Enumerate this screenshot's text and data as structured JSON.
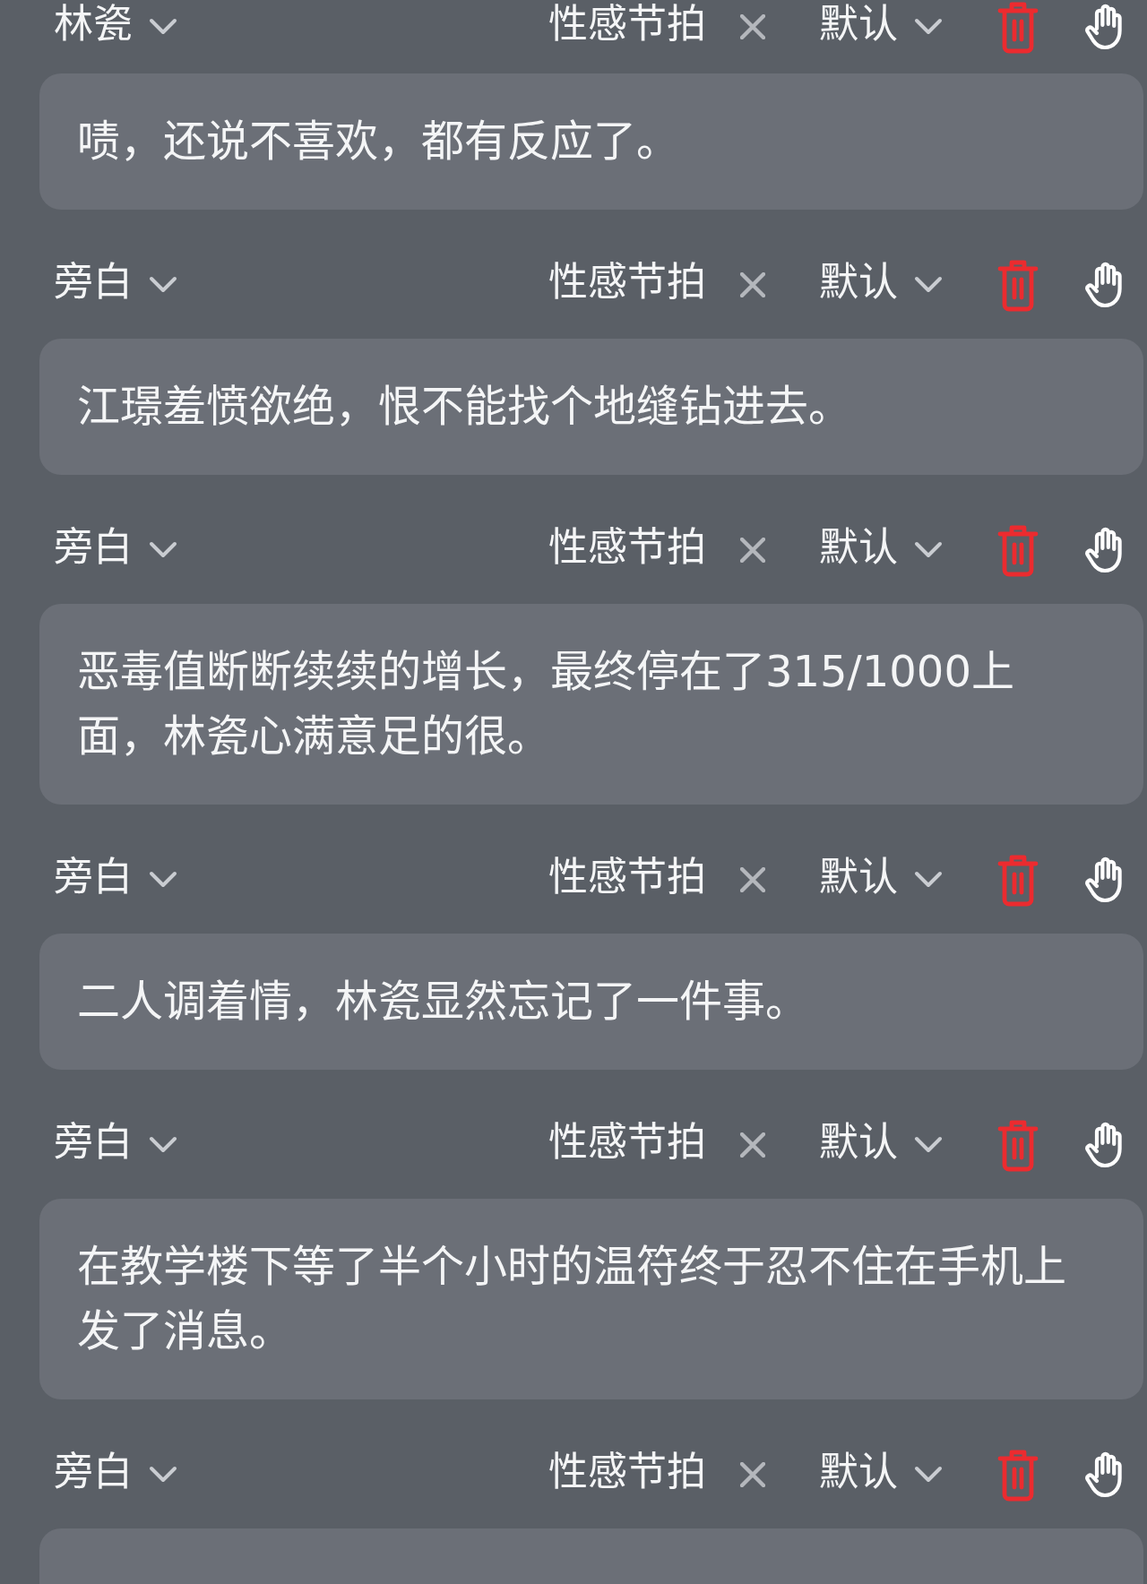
{
  "entries": [
    {
      "speaker": "林瓷",
      "music": "性感节拍",
      "voice": "默认",
      "text": "啧，还说不喜欢，都有反应了。"
    },
    {
      "speaker": "旁白",
      "music": "性感节拍",
      "voice": "默认",
      "text": "江璟羞愤欲绝，恨不能找个地缝钻进去。"
    },
    {
      "speaker": "旁白",
      "music": "性感节拍",
      "voice": "默认",
      "text": "恶毒值断断续续的增长，最终停在了315/1000上面，林瓷心满意足的很。"
    },
    {
      "speaker": "旁白",
      "music": "性感节拍",
      "voice": "默认",
      "text": "二人调着情，林瓷显然忘记了一件事。"
    },
    {
      "speaker": "旁白",
      "music": "性感节拍",
      "voice": "默认",
      "text": "在教学楼下等了半个小时的温符终于忍不住在手机上发了消息。"
    },
    {
      "speaker": "旁白",
      "music": "性感节拍",
      "voice": "默认"
    }
  ]
}
